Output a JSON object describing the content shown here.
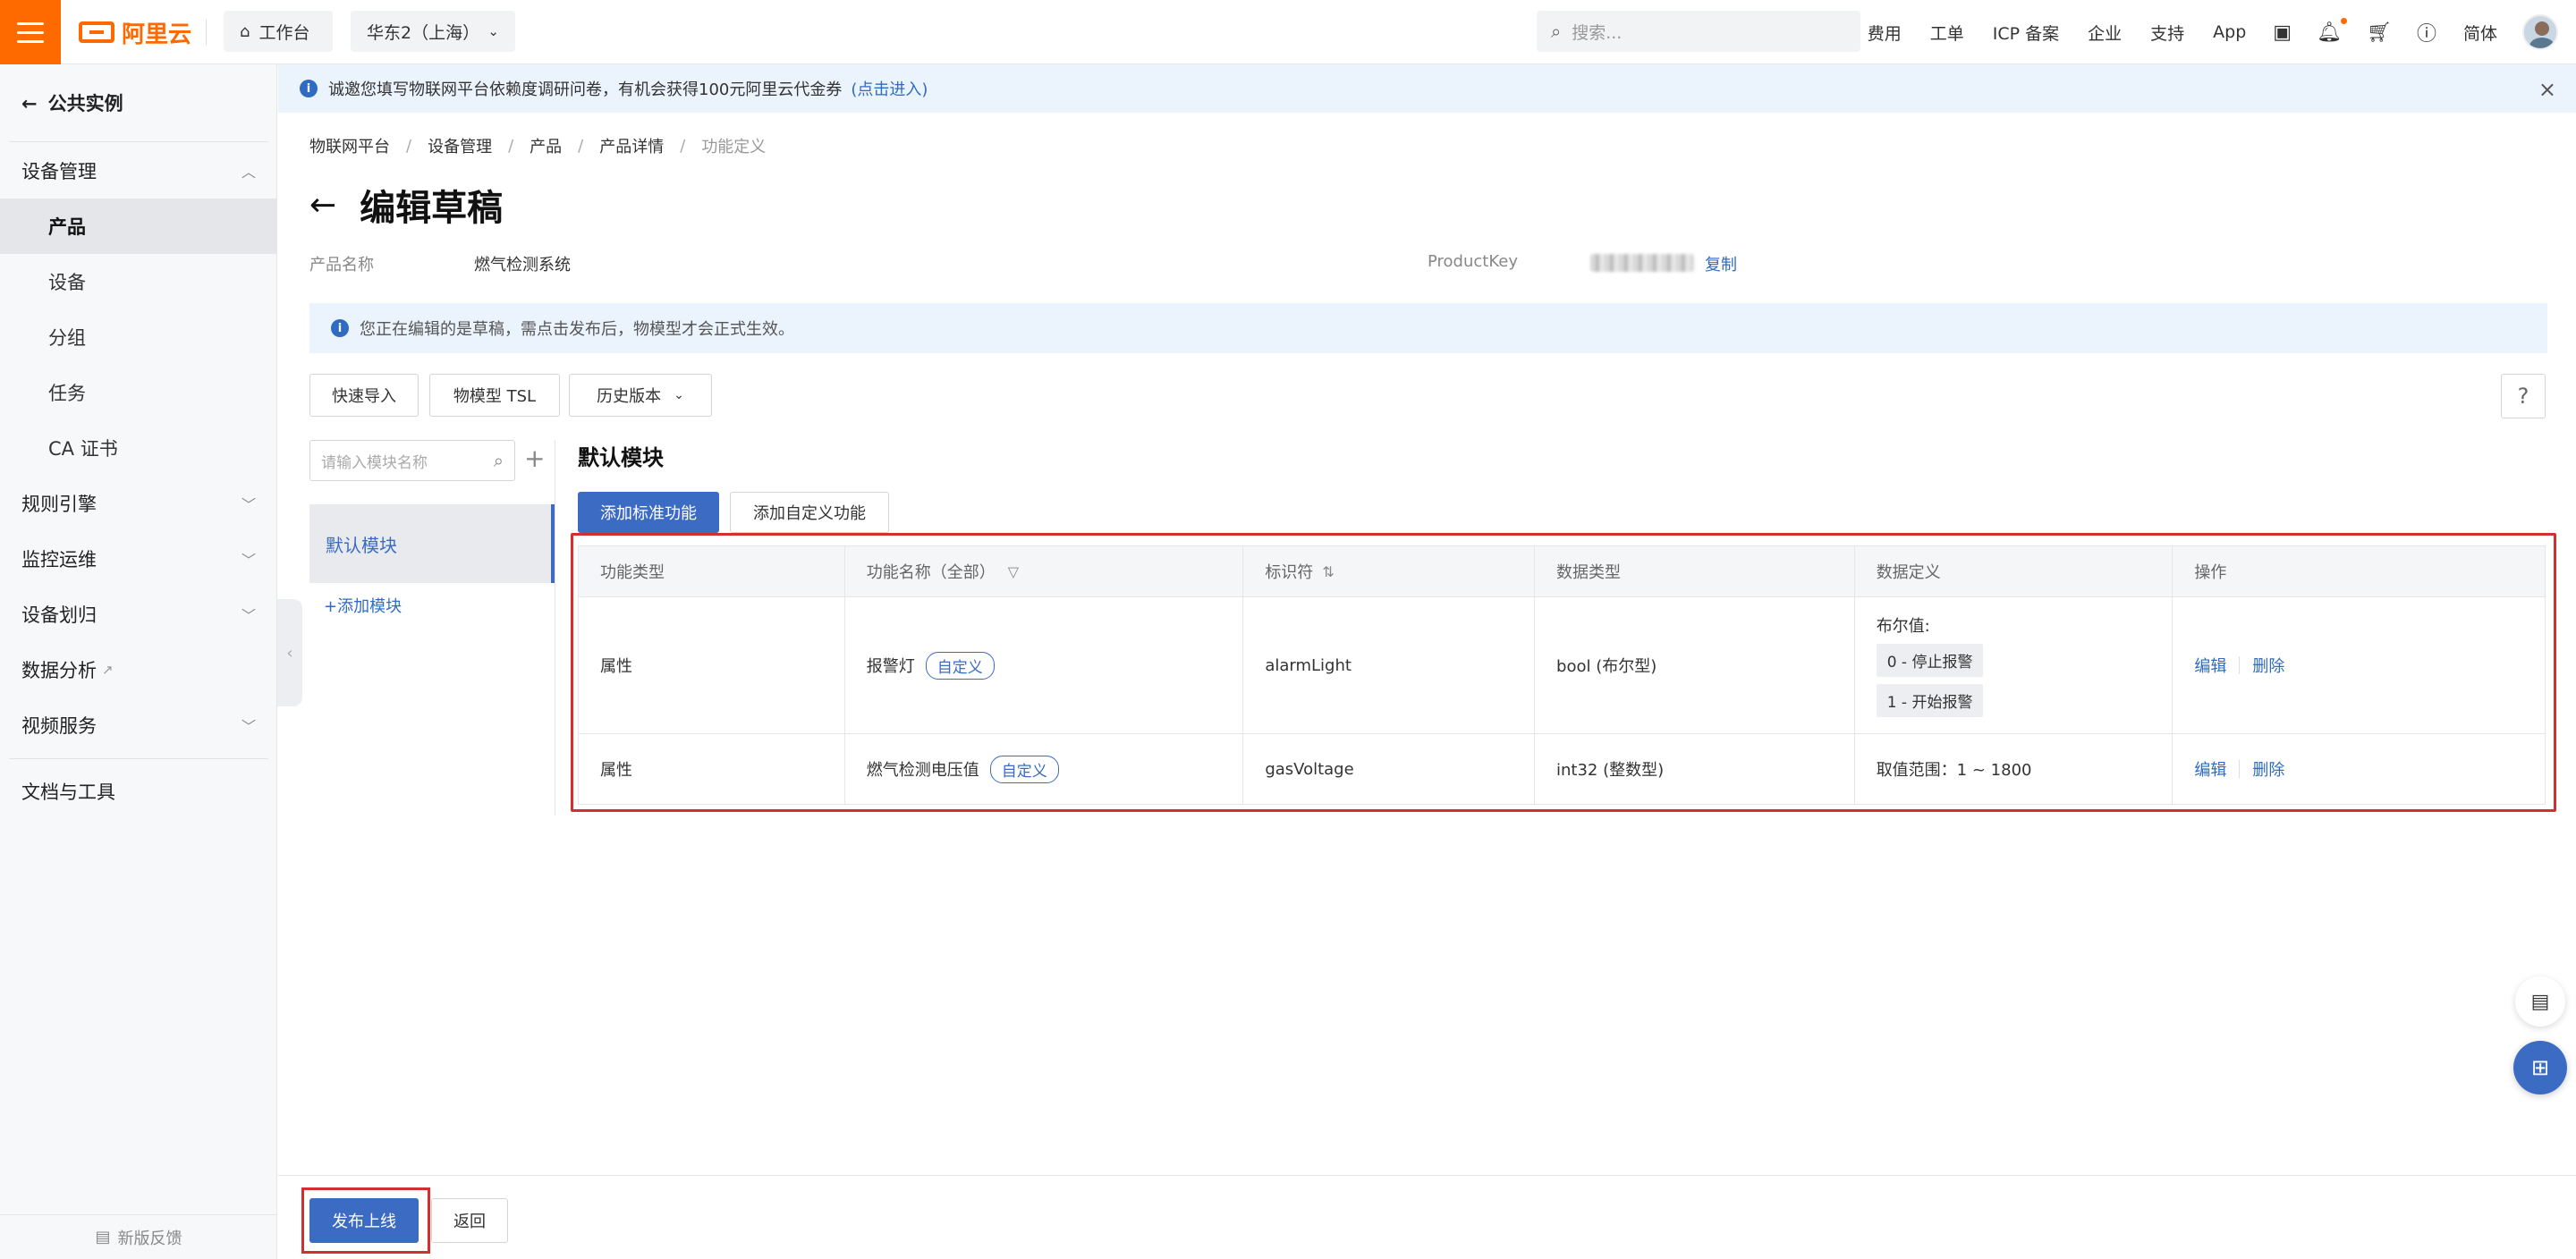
{
  "topbar": {
    "logo_text": "阿里云",
    "workbench": "工作台",
    "region": "华东2（上海）",
    "search_placeholder": "搜索...",
    "nav": [
      "费用",
      "工单",
      "ICP 备案",
      "企业",
      "支持",
      "App"
    ],
    "lang": "简体",
    "accent_color": "#ff6a00"
  },
  "sidebar": {
    "back_label": "公共实例",
    "groups": {
      "device_mgmt": "设备管理",
      "rules": "规则引擎",
      "monitor": "监控运维",
      "device_assign": "设备划归",
      "data_analysis": "数据分析",
      "video": "视频服务",
      "docs": "文档与工具"
    },
    "items": [
      "产品",
      "设备",
      "分组",
      "任务",
      "CA 证书"
    ],
    "active_item": "产品",
    "feedback": "新版反馈"
  },
  "banner": {
    "text": "诚邀您填写物联网平台依赖度调研问卷，有机会获得100元阿里云代金券",
    "link": "(点击进入)"
  },
  "breadcrumb": [
    "物联网平台",
    "设备管理",
    "产品",
    "产品详情",
    "功能定义"
  ],
  "page": {
    "title": "编辑草稿",
    "product_name_label": "产品名称",
    "product_name": "燃气检测系统",
    "product_key_label": "ProductKey",
    "copy_label": "复制",
    "draft_tip": "您正在编辑的是草稿，需点击发布后，物模型才会正式生效。"
  },
  "toolbar": {
    "quick_import": "快速导入",
    "tsl": "物模型 TSL",
    "history": "历史版本"
  },
  "modules": {
    "search_placeholder": "请输入模块名称",
    "items": [
      "默认模块"
    ],
    "add_link": "+添加模块",
    "current_title": "默认模块"
  },
  "feature_buttons": {
    "add_standard": "添加标准功能",
    "add_custom": "添加自定义功能"
  },
  "table": {
    "headers": [
      "功能类型",
      "功能名称（全部）",
      "标识符",
      "数据类型",
      "数据定义",
      "操作"
    ],
    "rows": [
      {
        "type": "属性",
        "name": "报警灯",
        "tag": "自定义",
        "identifier": "alarmLight",
        "data_type": "bool (布尔型)",
        "def_title": "布尔值:",
        "def_values": [
          "0 - 停止报警",
          "1 - 开始报警"
        ],
        "edit": "编辑",
        "delete": "删除"
      },
      {
        "type": "属性",
        "name": "燃气检测电压值",
        "tag": "自定义",
        "identifier": "gasVoltage",
        "data_type": "int32 (整数型)",
        "def_range": "取值范围：1 ~ 1800",
        "edit": "编辑",
        "delete": "删除"
      }
    ]
  },
  "footer": {
    "publish": "发布上线",
    "back": "返回"
  }
}
